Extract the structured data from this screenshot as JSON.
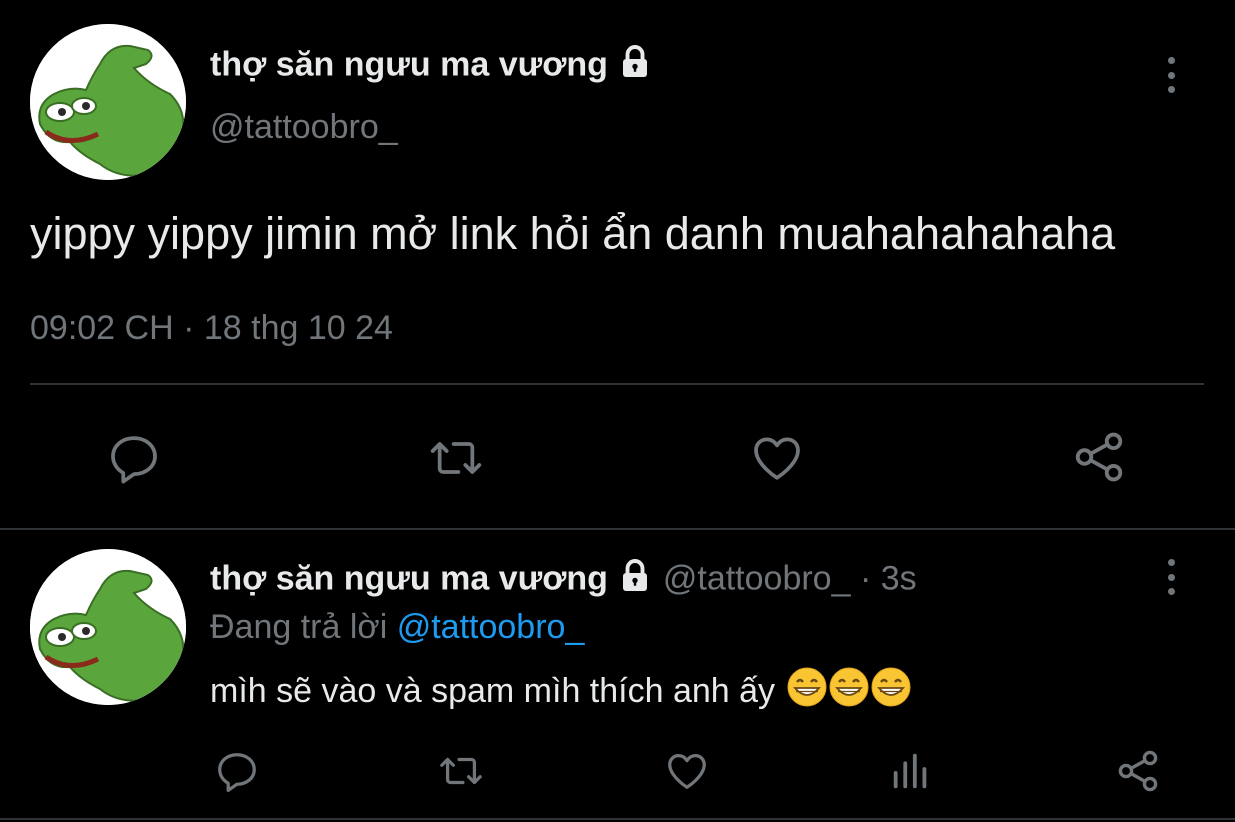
{
  "main_tweet": {
    "display_name": "thợ săn ngưu ma vương",
    "handle": "@tattoobro_",
    "text": "yippy yippy jimin mở link hỏi ẩn danh muahahahahaha",
    "time": "09:02 CH",
    "separator": "·",
    "date": "18 thg 10 24",
    "actions": [
      "reply-icon",
      "retweet-icon",
      "like-icon",
      "share-icon"
    ]
  },
  "reply_tweet": {
    "display_name": "thợ săn ngưu ma vương",
    "handle": "@tattoobro_",
    "separator": "·",
    "age": "3s",
    "replying_prefix": "Đang trả lời",
    "replying_to": "@tattoobro_",
    "text": "mìh sẽ vào và spam mìh thích anh ấy",
    "emojis": [
      "grinning-face",
      "grinning-face",
      "grinning-face"
    ],
    "actions": [
      "reply-icon",
      "retweet-icon",
      "like-icon",
      "analytics-icon",
      "share-icon"
    ]
  },
  "colors": {
    "background": "#000000",
    "text": "#e7e9ea",
    "muted": "#71767b",
    "link": "#1d9bf0",
    "divider": "#2f3336"
  }
}
